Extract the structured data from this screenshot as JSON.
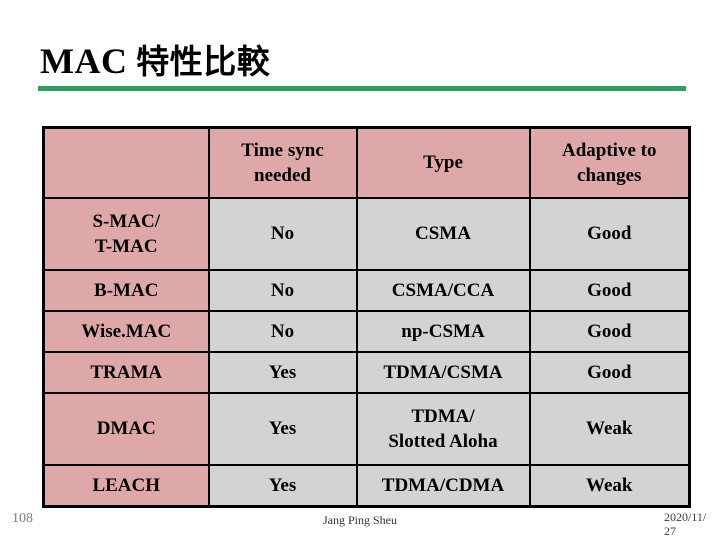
{
  "slide": {
    "title_latin": "MAC",
    "title_cjk": "特性比較",
    "rule_color": "#2e9e63"
  },
  "table": {
    "header_bg": "#dfa8a8",
    "cell_bg": "#d3d3d3",
    "border_color": "#000000",
    "columns": [
      "",
      "Time sync needed",
      "Type",
      "Adaptive to changes"
    ],
    "columns_lines": {
      "col2_line1": "Time sync",
      "col2_line2": "needed",
      "col3_line1": "Type",
      "col4_line1": "Adaptive  to",
      "col4_line2": "changes"
    },
    "rows": [
      {
        "protocol_line1": "S-MAC/",
        "protocol_line2": "T-MAC",
        "time_sync": "No",
        "type_line1": "CSMA",
        "type_line2": "",
        "adaptive": "Good"
      },
      {
        "protocol_line1": "B-MAC",
        "protocol_line2": "",
        "time_sync": "No",
        "type_line1": "CSMA/CCA",
        "type_line2": "",
        "adaptive": "Good"
      },
      {
        "protocol_line1": "Wise.MAC",
        "protocol_line2": "",
        "time_sync": "No",
        "type_line1": "np-CSMA",
        "type_line2": "",
        "adaptive": "Good"
      },
      {
        "protocol_line1": "TRAMA",
        "protocol_line2": "",
        "time_sync": "Yes",
        "type_line1": "TDMA/CSMA",
        "type_line2": "",
        "adaptive": "Good"
      },
      {
        "protocol_line1": "DMAC",
        "protocol_line2": "",
        "time_sync": "Yes",
        "type_line1": "TDMA/",
        "type_line2": "Slotted Aloha",
        "adaptive": "Weak"
      },
      {
        "protocol_line1": "LEACH",
        "protocol_line2": "",
        "time_sync": "Yes",
        "type_line1": "TDMA/CDMA",
        "type_line2": "",
        "adaptive": "Weak"
      }
    ]
  },
  "footer": {
    "page_number": "108",
    "author": "Jang Ping Sheu",
    "date": "2020/11/27"
  }
}
